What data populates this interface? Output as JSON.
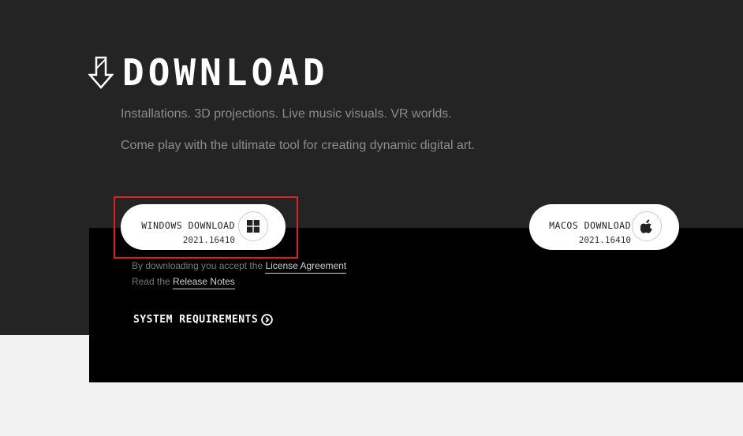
{
  "hero": {
    "title": "DOWNLOAD",
    "tagline_1": "Installations. 3D projections. Live music visuals. VR worlds.",
    "tagline_2": "Come play with the ultimate tool for creating dynamic digital art."
  },
  "downloads": {
    "windows": {
      "label": "WINDOWS DOWNLOAD",
      "version": "2021.16410",
      "icon": "windows-logo-icon"
    },
    "macos": {
      "label": "MACOS DOWNLOAD",
      "version": "2021.16410",
      "icon": "apple-logo-icon"
    }
  },
  "legal": {
    "license_prefix": "By downloading you accept the",
    "license_link": "License Agreement",
    "notes_prefix": "Read the",
    "notes_link": "Release Notes"
  },
  "system_requirements": {
    "label": "SYSTEM REQUIREMENTS",
    "icon": "circle-arrow-right-icon"
  },
  "colors": {
    "hero_bg": "#242424",
    "panel_bg": "#000000",
    "page_bg": "#f2f2f2",
    "highlight": "#e02020"
  }
}
